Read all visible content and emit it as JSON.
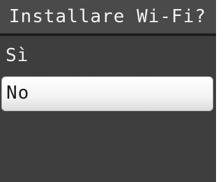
{
  "title": "Installare Wi-Fi?",
  "options": [
    {
      "label": "Sì",
      "selected": false
    },
    {
      "label": "No",
      "selected": true
    }
  ],
  "colors": {
    "background": "#3e3e3e",
    "title_bar": "#4a4a4a",
    "title_text": "#f2f2f2",
    "selected_background": "#ffffff",
    "selected_text": "#1a1a1a"
  }
}
